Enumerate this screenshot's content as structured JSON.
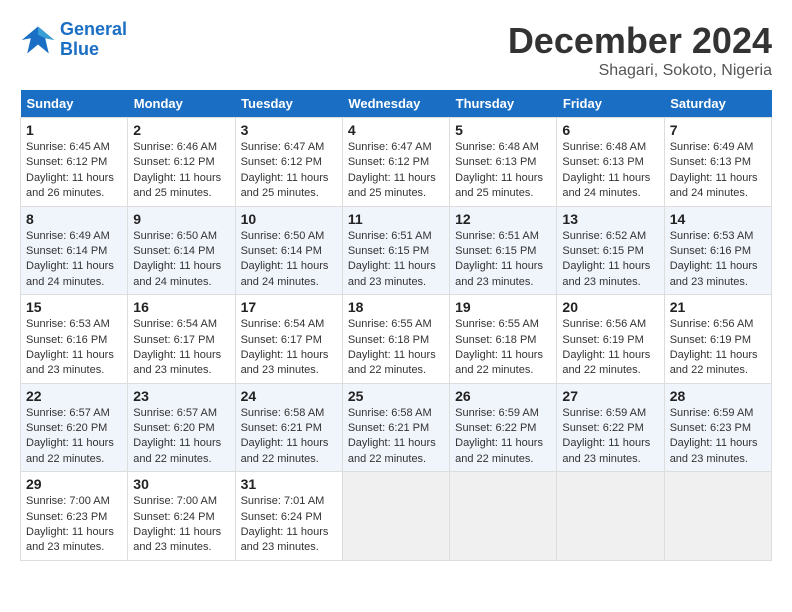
{
  "header": {
    "logo_line1": "General",
    "logo_line2": "Blue",
    "month": "December 2024",
    "location": "Shagari, Sokoto, Nigeria"
  },
  "days_of_week": [
    "Sunday",
    "Monday",
    "Tuesday",
    "Wednesday",
    "Thursday",
    "Friday",
    "Saturday"
  ],
  "weeks": [
    [
      {
        "day": "1",
        "info": "Sunrise: 6:45 AM\nSunset: 6:12 PM\nDaylight: 11 hours\nand 26 minutes."
      },
      {
        "day": "2",
        "info": "Sunrise: 6:46 AM\nSunset: 6:12 PM\nDaylight: 11 hours\nand 25 minutes."
      },
      {
        "day": "3",
        "info": "Sunrise: 6:47 AM\nSunset: 6:12 PM\nDaylight: 11 hours\nand 25 minutes."
      },
      {
        "day": "4",
        "info": "Sunrise: 6:47 AM\nSunset: 6:12 PM\nDaylight: 11 hours\nand 25 minutes."
      },
      {
        "day": "5",
        "info": "Sunrise: 6:48 AM\nSunset: 6:13 PM\nDaylight: 11 hours\nand 25 minutes."
      },
      {
        "day": "6",
        "info": "Sunrise: 6:48 AM\nSunset: 6:13 PM\nDaylight: 11 hours\nand 24 minutes."
      },
      {
        "day": "7",
        "info": "Sunrise: 6:49 AM\nSunset: 6:13 PM\nDaylight: 11 hours\nand 24 minutes."
      }
    ],
    [
      {
        "day": "8",
        "info": "Sunrise: 6:49 AM\nSunset: 6:14 PM\nDaylight: 11 hours\nand 24 minutes."
      },
      {
        "day": "9",
        "info": "Sunrise: 6:50 AM\nSunset: 6:14 PM\nDaylight: 11 hours\nand 24 minutes."
      },
      {
        "day": "10",
        "info": "Sunrise: 6:50 AM\nSunset: 6:14 PM\nDaylight: 11 hours\nand 24 minutes."
      },
      {
        "day": "11",
        "info": "Sunrise: 6:51 AM\nSunset: 6:15 PM\nDaylight: 11 hours\nand 23 minutes."
      },
      {
        "day": "12",
        "info": "Sunrise: 6:51 AM\nSunset: 6:15 PM\nDaylight: 11 hours\nand 23 minutes."
      },
      {
        "day": "13",
        "info": "Sunrise: 6:52 AM\nSunset: 6:15 PM\nDaylight: 11 hours\nand 23 minutes."
      },
      {
        "day": "14",
        "info": "Sunrise: 6:53 AM\nSunset: 6:16 PM\nDaylight: 11 hours\nand 23 minutes."
      }
    ],
    [
      {
        "day": "15",
        "info": "Sunrise: 6:53 AM\nSunset: 6:16 PM\nDaylight: 11 hours\nand 23 minutes."
      },
      {
        "day": "16",
        "info": "Sunrise: 6:54 AM\nSunset: 6:17 PM\nDaylight: 11 hours\nand 23 minutes."
      },
      {
        "day": "17",
        "info": "Sunrise: 6:54 AM\nSunset: 6:17 PM\nDaylight: 11 hours\nand 23 minutes."
      },
      {
        "day": "18",
        "info": "Sunrise: 6:55 AM\nSunset: 6:18 PM\nDaylight: 11 hours\nand 22 minutes."
      },
      {
        "day": "19",
        "info": "Sunrise: 6:55 AM\nSunset: 6:18 PM\nDaylight: 11 hours\nand 22 minutes."
      },
      {
        "day": "20",
        "info": "Sunrise: 6:56 AM\nSunset: 6:19 PM\nDaylight: 11 hours\nand 22 minutes."
      },
      {
        "day": "21",
        "info": "Sunrise: 6:56 AM\nSunset: 6:19 PM\nDaylight: 11 hours\nand 22 minutes."
      }
    ],
    [
      {
        "day": "22",
        "info": "Sunrise: 6:57 AM\nSunset: 6:20 PM\nDaylight: 11 hours\nand 22 minutes."
      },
      {
        "day": "23",
        "info": "Sunrise: 6:57 AM\nSunset: 6:20 PM\nDaylight: 11 hours\nand 22 minutes."
      },
      {
        "day": "24",
        "info": "Sunrise: 6:58 AM\nSunset: 6:21 PM\nDaylight: 11 hours\nand 22 minutes."
      },
      {
        "day": "25",
        "info": "Sunrise: 6:58 AM\nSunset: 6:21 PM\nDaylight: 11 hours\nand 22 minutes."
      },
      {
        "day": "26",
        "info": "Sunrise: 6:59 AM\nSunset: 6:22 PM\nDaylight: 11 hours\nand 22 minutes."
      },
      {
        "day": "27",
        "info": "Sunrise: 6:59 AM\nSunset: 6:22 PM\nDaylight: 11 hours\nand 23 minutes."
      },
      {
        "day": "28",
        "info": "Sunrise: 6:59 AM\nSunset: 6:23 PM\nDaylight: 11 hours\nand 23 minutes."
      }
    ],
    [
      {
        "day": "29",
        "info": "Sunrise: 7:00 AM\nSunset: 6:23 PM\nDaylight: 11 hours\nand 23 minutes."
      },
      {
        "day": "30",
        "info": "Sunrise: 7:00 AM\nSunset: 6:24 PM\nDaylight: 11 hours\nand 23 minutes."
      },
      {
        "day": "31",
        "info": "Sunrise: 7:01 AM\nSunset: 6:24 PM\nDaylight: 11 hours\nand 23 minutes."
      },
      {
        "day": "",
        "info": ""
      },
      {
        "day": "",
        "info": ""
      },
      {
        "day": "",
        "info": ""
      },
      {
        "day": "",
        "info": ""
      }
    ]
  ]
}
